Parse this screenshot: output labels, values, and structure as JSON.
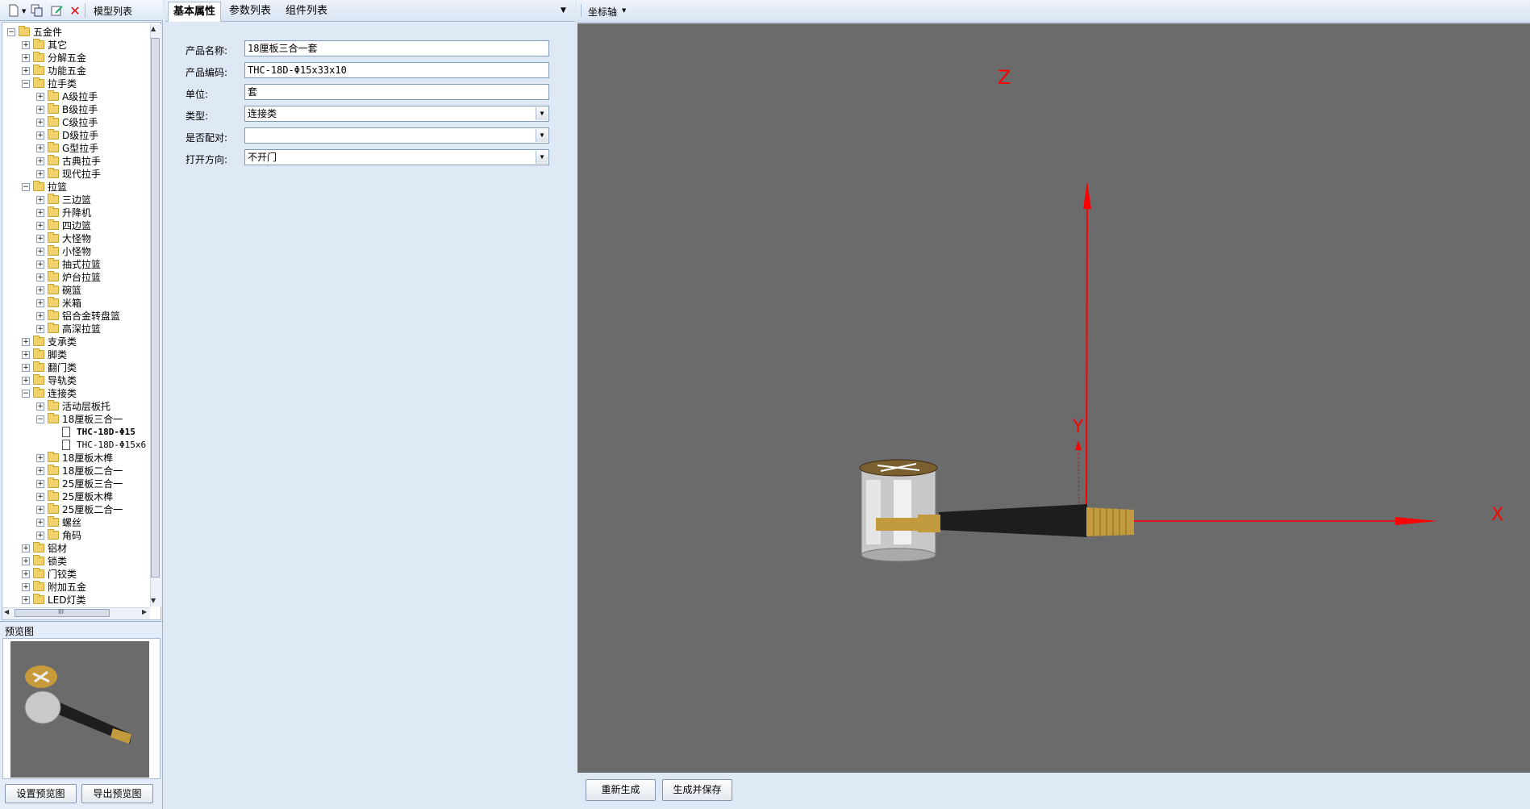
{
  "left_toolbar": {
    "icons": [
      "new-file-icon",
      "copy-icon",
      "edit-icon",
      "delete-icon"
    ],
    "title": "模型列表"
  },
  "tree": {
    "nodes": [
      {
        "label": "五金件",
        "level": 0,
        "expand": "−",
        "kind": "folder"
      },
      {
        "label": "其它",
        "level": 1,
        "expand": "+",
        "kind": "folder"
      },
      {
        "label": "分解五金",
        "level": 1,
        "expand": "+",
        "kind": "folder"
      },
      {
        "label": "功能五金",
        "level": 1,
        "expand": "+",
        "kind": "folder"
      },
      {
        "label": "拉手类",
        "level": 1,
        "expand": "−",
        "kind": "folder"
      },
      {
        "label": "A级拉手",
        "level": 2,
        "expand": "+",
        "kind": "folder"
      },
      {
        "label": "B级拉手",
        "level": 2,
        "expand": "+",
        "kind": "folder"
      },
      {
        "label": "C级拉手",
        "level": 2,
        "expand": "+",
        "kind": "folder"
      },
      {
        "label": "D级拉手",
        "level": 2,
        "expand": "+",
        "kind": "folder"
      },
      {
        "label": "G型拉手",
        "level": 2,
        "expand": "+",
        "kind": "folder"
      },
      {
        "label": "古典拉手",
        "level": 2,
        "expand": "+",
        "kind": "folder"
      },
      {
        "label": "现代拉手",
        "level": 2,
        "expand": "+",
        "kind": "folder"
      },
      {
        "label": "拉篮",
        "level": 1,
        "expand": "−",
        "kind": "folder"
      },
      {
        "label": "三边篮",
        "level": 2,
        "expand": "+",
        "kind": "folder"
      },
      {
        "label": "升降机",
        "level": 2,
        "expand": "+",
        "kind": "folder"
      },
      {
        "label": "四边篮",
        "level": 2,
        "expand": "+",
        "kind": "folder"
      },
      {
        "label": "大怪物",
        "level": 2,
        "expand": "+",
        "kind": "folder"
      },
      {
        "label": "小怪物",
        "level": 2,
        "expand": "+",
        "kind": "folder"
      },
      {
        "label": "抽式拉篮",
        "level": 2,
        "expand": "+",
        "kind": "folder"
      },
      {
        "label": "炉台拉篮",
        "level": 2,
        "expand": "+",
        "kind": "folder"
      },
      {
        "label": "碗篮",
        "level": 2,
        "expand": "+",
        "kind": "folder"
      },
      {
        "label": "米箱",
        "level": 2,
        "expand": "+",
        "kind": "folder"
      },
      {
        "label": "铝合金转盘篮",
        "level": 2,
        "expand": "+",
        "kind": "folder"
      },
      {
        "label": "高深拉篮",
        "level": 2,
        "expand": "+",
        "kind": "folder"
      },
      {
        "label": "支承类",
        "level": 1,
        "expand": "+",
        "kind": "folder"
      },
      {
        "label": "脚类",
        "level": 1,
        "expand": "+",
        "kind": "folder"
      },
      {
        "label": "翻门类",
        "level": 1,
        "expand": "+",
        "kind": "folder"
      },
      {
        "label": "导轨类",
        "level": 1,
        "expand": "+",
        "kind": "folder"
      },
      {
        "label": "连接类",
        "level": 1,
        "expand": "−",
        "kind": "folder"
      },
      {
        "label": "活动层板托",
        "level": 2,
        "expand": "+",
        "kind": "folder"
      },
      {
        "label": "18厘板三合一",
        "level": 2,
        "expand": "−",
        "kind": "folder"
      },
      {
        "label": "THC-18D-Φ15",
        "level": 3,
        "expand": "",
        "kind": "file",
        "bold": true
      },
      {
        "label": "THC-18D-Φ15x6",
        "level": 3,
        "expand": "",
        "kind": "file"
      },
      {
        "label": "18厘板木榫",
        "level": 2,
        "expand": "+",
        "kind": "folder"
      },
      {
        "label": "18厘板二合一",
        "level": 2,
        "expand": "+",
        "kind": "folder"
      },
      {
        "label": "25厘板三合一",
        "level": 2,
        "expand": "+",
        "kind": "folder"
      },
      {
        "label": "25厘板木榫",
        "level": 2,
        "expand": "+",
        "kind": "folder"
      },
      {
        "label": "25厘板二合一",
        "level": 2,
        "expand": "+",
        "kind": "folder"
      },
      {
        "label": "螺丝",
        "level": 2,
        "expand": "+",
        "kind": "folder"
      },
      {
        "label": "角码",
        "level": 2,
        "expand": "+",
        "kind": "folder"
      },
      {
        "label": "铝材",
        "level": 1,
        "expand": "+",
        "kind": "folder"
      },
      {
        "label": "锁类",
        "level": 1,
        "expand": "+",
        "kind": "folder"
      },
      {
        "label": "门铰类",
        "level": 1,
        "expand": "+",
        "kind": "folder"
      },
      {
        "label": "附加五金",
        "level": 1,
        "expand": "+",
        "kind": "folder"
      },
      {
        "label": "LED灯类",
        "level": 1,
        "expand": "+",
        "kind": "folder"
      }
    ],
    "hscroll_grip": "III"
  },
  "preview": {
    "label": "预览图",
    "set_button": "设置预览图",
    "export_button": "导出预览图"
  },
  "tabs": [
    "基本属性",
    "参数列表",
    "组件列表"
  ],
  "form": {
    "name_label": "产品名称:",
    "name_value": "18厘板三合一套",
    "code_label": "产品编码:",
    "code_value": "THC-18D-Φ15x33x10",
    "unit_label": "单位:",
    "unit_value": "套",
    "type_label": "类型:",
    "type_value": "连接类",
    "paired_label": "是否配对:",
    "paired_value": "",
    "direction_label": "打开方向:",
    "direction_value": "不开门"
  },
  "viewport": {
    "axis_menu": "坐标轴",
    "axis_x": "X",
    "axis_y": "Y",
    "axis_z": "Z",
    "axis_color": "#ff0000",
    "background": "#6b6b6b"
  },
  "actions": {
    "regenerate": "重新生成",
    "generate_save": "生成并保存"
  }
}
